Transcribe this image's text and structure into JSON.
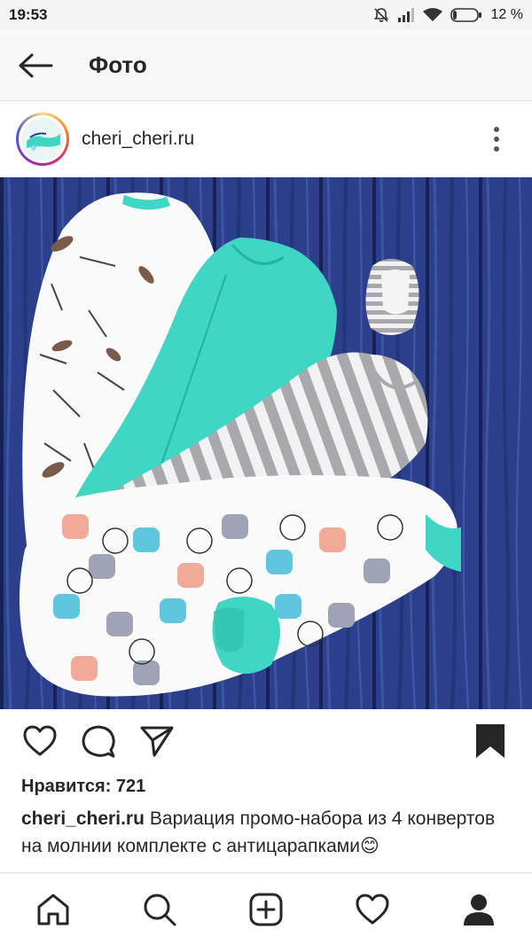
{
  "status_bar": {
    "time": "19:53",
    "battery": "12 %",
    "icons": [
      "bell-off-icon",
      "signal-icon",
      "wifi-icon",
      "battery-icon"
    ]
  },
  "app_bar": {
    "title": "Фото",
    "back_icon": "arrow-left-icon"
  },
  "post": {
    "username": "cheri_cheri.ru",
    "more_icon": "vertical-dots-icon",
    "likes_label": "Нравится: 721",
    "caption_user": "cheri_cheri.ru",
    "caption_text": "Вариация промо-набора из 4 конвертов на молнии  комплекте с антицарапками😊",
    "actions": [
      "heart-icon",
      "comment-icon",
      "send-icon",
      "bookmark-icon"
    ]
  },
  "colors": {
    "teal": "#3fd6c3",
    "wood_blue": "#2a3f8a",
    "text": "#262626"
  },
  "bottom_nav": [
    "home-icon",
    "search-icon",
    "add-icon",
    "activity-heart-icon",
    "profile-icon"
  ]
}
